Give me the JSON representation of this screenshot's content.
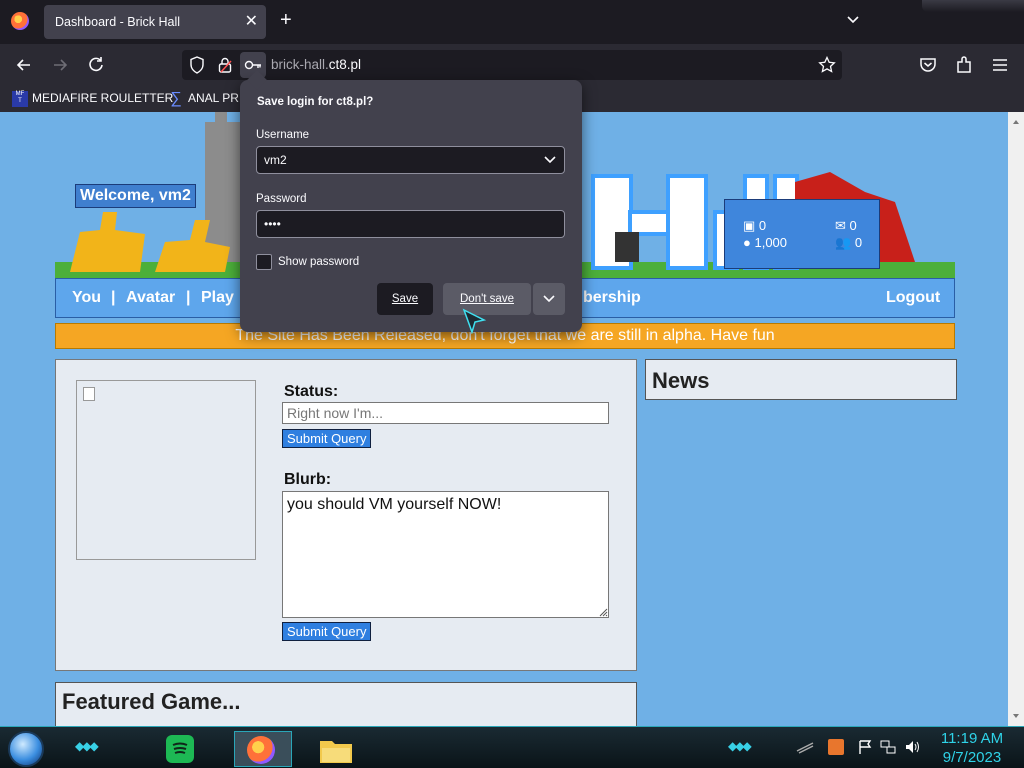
{
  "browser": {
    "tab_title": "Dashboard - Brick Hall",
    "url_host_dim": "brick-hall.",
    "url_host_main": "ct8.pl",
    "bookmarks": [
      {
        "label": "MEDIAFIRE ROULETTER",
        "icon": "mediafire-icon"
      },
      {
        "label": "ANAL PR",
        "icon": "sigma-icon"
      }
    ]
  },
  "site": {
    "welcome": "Welcome, vm2",
    "stats": {
      "bucks": "0",
      "bits": "1,000",
      "messages": "0",
      "friends": "0"
    },
    "nav": {
      "you": "You",
      "avatar": "Avatar",
      "play": "Play",
      "membership": "bership",
      "logout": "Logout",
      "separator": "|"
    },
    "announcement": "The Site Has Been Released, don't forget that we are still in alpha. Have fun",
    "status_label": "Status:",
    "status_placeholder": "Right now I'm...",
    "submit_label": "Submit Query",
    "blurb_label": "Blurb:",
    "blurb_value": "you should VM yourself NOW!",
    "news_title": "News",
    "featured_title": "Featured Game..."
  },
  "popup": {
    "title": "Save login for ct8.pl?",
    "username_label": "Username",
    "username_value": "vm2",
    "password_label": "Password",
    "password_value": "••••",
    "show_password": "Show password",
    "save": "Save",
    "dont_save": "Don't save"
  },
  "taskbar": {
    "time": "11:19 AM",
    "date": "9/7/2023"
  },
  "colors": {
    "page_bg": "#6fb0e6",
    "nav_bg": "#5ea6ec",
    "announcement_bg": "#f5a623",
    "popup_bg": "#42414d",
    "clock": "#2fd3e8"
  }
}
